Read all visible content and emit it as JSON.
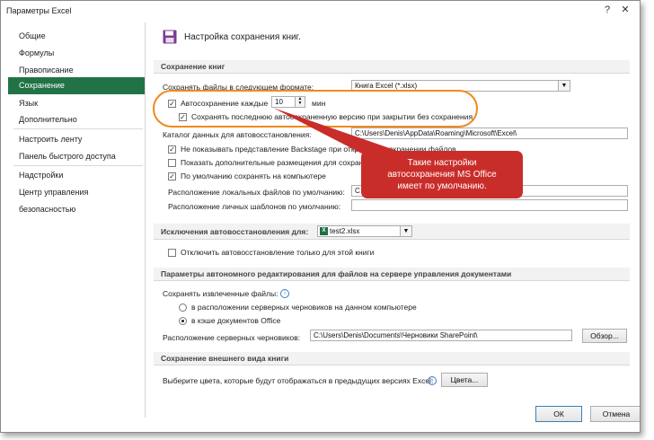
{
  "window": {
    "title": "Параметры Excel",
    "help_icon": "help-icon",
    "close_icon": "close-icon"
  },
  "sidebar": {
    "items": [
      {
        "label": "Общие"
      },
      {
        "label": "Формулы"
      },
      {
        "label": "Правописание"
      },
      {
        "label": "Сохранение",
        "selected": true
      },
      {
        "label": "Язык"
      },
      {
        "label": "Дополнительно"
      },
      {
        "label": "Настроить ленту"
      },
      {
        "label": "Панель быстрого доступа"
      },
      {
        "label": "Надстройки"
      },
      {
        "label": "Центр управления безопасностью"
      }
    ]
  },
  "page": {
    "heading": "Настройка сохранения книг.",
    "icon": "floppy-disk-icon"
  },
  "save_section": {
    "header": "Сохранение книг",
    "format_label": "Сохранять файлы в следующем формате:",
    "format_value": "Книга Excel (*.xlsx)",
    "autosave_label": "Автосохранение каждые",
    "autosave_checked": true,
    "autosave_minutes": "10",
    "autosave_unit": "мин",
    "keep_last_label": "Сохранять последнюю автосохраненную версию при закрытии без сохранения",
    "keep_last_checked": true,
    "recovery_dir_label": "Каталог данных для автовосстановления:",
    "recovery_dir_value": "C:\\Users\\Denis\\AppData\\Roaming\\Microsoft\\Excel\\",
    "no_backstage_label": "Не показывать представление Backstage при открытии и сохранении файлов",
    "no_backstage_checked": true,
    "show_extra_label": "Показать дополнительные размещения для сохранения, даже если требуется вход в систему",
    "show_extra_checked": false,
    "save_local_label": "По умолчанию сохранять на компьютере",
    "save_local_checked": true,
    "local_default_label": "Расположение локальных файлов по умолчанию:",
    "local_default_value": "C",
    "personal_templates_label": "Расположение личных шаблонов по умолчанию:",
    "personal_templates_value": ""
  },
  "exceptions_section": {
    "header_label": "Исключения автовосстановления для:",
    "workbook": "test2.xlsx",
    "workbook_icon": "excel-file-icon",
    "disable_label": "Отключить автовосстановление только для этой книги",
    "disable_checked": false
  },
  "offline_section": {
    "header": "Параметры автономного редактирования для файлов на сервере управления документами",
    "save_extracted_label": "Сохранять извлеченные файлы:",
    "info_icon": "info-icon",
    "option_server": "в расположении серверных черновиков на данном компьютере",
    "option_cache": "в кэше документов Office",
    "selected_option": "option_cache",
    "drafts_label": "Расположение серверных черновиков:",
    "drafts_value": "C:\\Users\\Denis\\Documents\\Черновики SharePoint\\",
    "browse_label": "Обзор..."
  },
  "appearance_section": {
    "header": "Сохранение внешнего вида книги",
    "colors_label": "Выберите цвета, которые будут отображаться в предыдущих версиях Excel:",
    "info_icon": "info-icon",
    "colors_button": "Цвета..."
  },
  "footer": {
    "ok": "ОК",
    "cancel": "Отмена"
  },
  "callout": {
    "line1": "Такие настройки",
    "line2": "автосохранения  MS Office",
    "line3": "имеет по умолчанию.",
    "color": "#c92d2a"
  },
  "highlight": {
    "color": "#f08a1c"
  }
}
